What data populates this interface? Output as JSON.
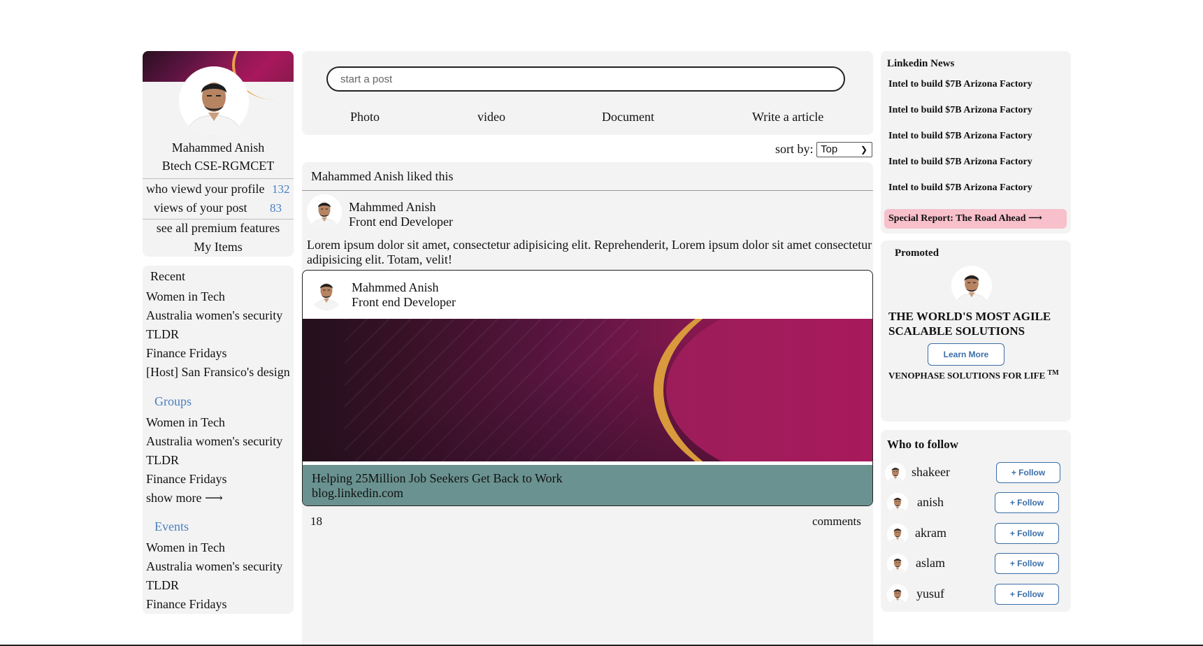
{
  "profile": {
    "name": "Mahammed Anish",
    "headline": "Btech CSE-RGMCET",
    "stats": [
      {
        "label": "who viewd your profile",
        "value": "132"
      },
      {
        "label": "views of your post",
        "value": "83"
      }
    ],
    "premium_link": "see all premium features",
    "items_link": "My Items"
  },
  "recent": {
    "title": "Recent",
    "items": [
      "Women in Tech",
      "Australia women's security",
      "TLDR",
      "Finance Fridays",
      "[Host] San Fransico's design"
    ],
    "groups_title": "Groups",
    "groups": [
      "Women in Tech",
      "Australia women's security",
      "TLDR",
      "Finance Fridays"
    ],
    "show_more": "show more ⟶",
    "events_title": "Events",
    "events": [
      "Women in Tech",
      "Australia women's security",
      "TLDR",
      "Finance Fridays"
    ]
  },
  "composer": {
    "placeholder": "start a post",
    "actions": [
      "Photo",
      "video",
      "Document",
      "Write a article"
    ]
  },
  "sort": {
    "label": "sort by:",
    "value": "Top"
  },
  "post": {
    "liked_by": "Mahammed Anish liked this",
    "author": "Mahmmed Anish",
    "role": "Front end Developer",
    "text": "Lorem ipsum dolor sit amet, consectetur adipisicing elit. Reprehenderit, Lorem ipsum dolor sit amet consectetur adipisicing elit. Totam, velit!",
    "shared": {
      "author": "Mahmmed Anish",
      "role": "Front end Developer",
      "title": "Helping 25Million Job Seekers Get Back to Work",
      "url": "blog.linkedin.com"
    },
    "likes": "18",
    "comments_label": "comments"
  },
  "news": {
    "title": "Linkedin News",
    "items": [
      "Intel to build $7B Arizona Factory",
      "Intel to build $7B Arizona Factory",
      "Intel to build $7B Arizona Factory",
      "Intel to build $7B Arizona Factory",
      "Intel to build $7B Arizona Factory"
    ],
    "special": "Special Report: The Road Ahead ⟶"
  },
  "promoted": {
    "label": "Promoted",
    "headline": "THE WORLD'S MOST AGILE SCALABLE SOLUTIONS",
    "button": "Learn More",
    "tagline": "VENOPHASE SOLUTIONS FOR LIFE",
    "tm": "TM"
  },
  "follow": {
    "title": "Who to follow",
    "button": "+ Follow",
    "people": [
      "shakeer",
      "anish",
      "akram",
      "aslam",
      "yusuf"
    ]
  },
  "colors": {
    "accent": "#4a7fc0",
    "card": "#f3f3f3",
    "special": "#f7c0cb",
    "shared_footer": "#6a9290"
  }
}
